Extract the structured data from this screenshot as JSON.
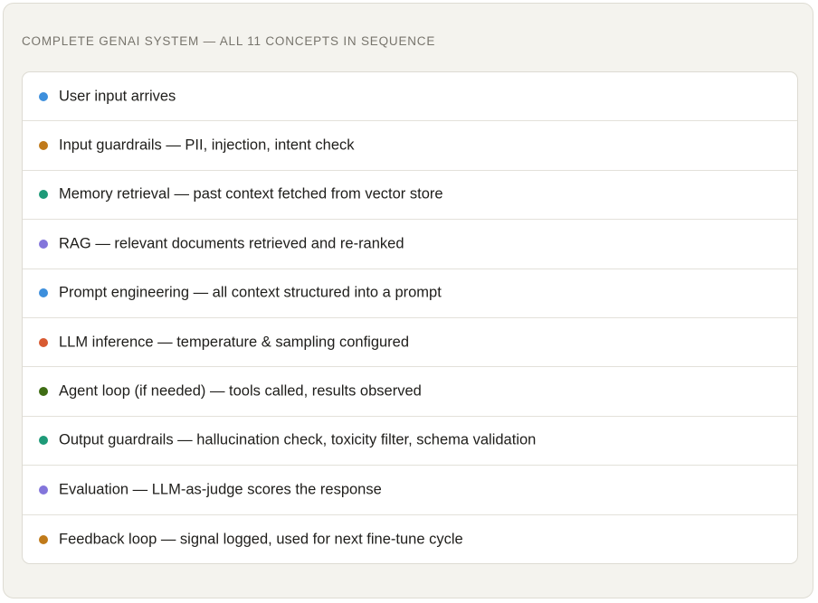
{
  "heading": "COMPLETE GENAI SYSTEM — ALL 11 CONCEPTS IN SEQUENCE",
  "steps": [
    {
      "label": "User input arrives",
      "color": "#3d8fdc"
    },
    {
      "label": "Input guardrails — PII, injection, intent check",
      "color": "#c07a1a"
    },
    {
      "label": "Memory retrieval — past context fetched from vector store",
      "color": "#1e9a78"
    },
    {
      "label": "RAG — relevant documents retrieved and re-ranked",
      "color": "#8375db"
    },
    {
      "label": "Prompt engineering — all context structured into a prompt",
      "color": "#3d8fdc"
    },
    {
      "label": "LLM inference — temperature & sampling configured",
      "color": "#d85a32"
    },
    {
      "label": "Agent loop (if needed) — tools called, results observed",
      "color": "#3f6d14"
    },
    {
      "label": "Output guardrails — hallucination check, toxicity filter, schema validation",
      "color": "#1e9a78"
    },
    {
      "label": "Evaluation — LLM-as-judge scores the response",
      "color": "#8375db"
    },
    {
      "label": "Feedback loop — signal logged, used for next fine-tune cycle",
      "color": "#c07a1a"
    }
  ]
}
